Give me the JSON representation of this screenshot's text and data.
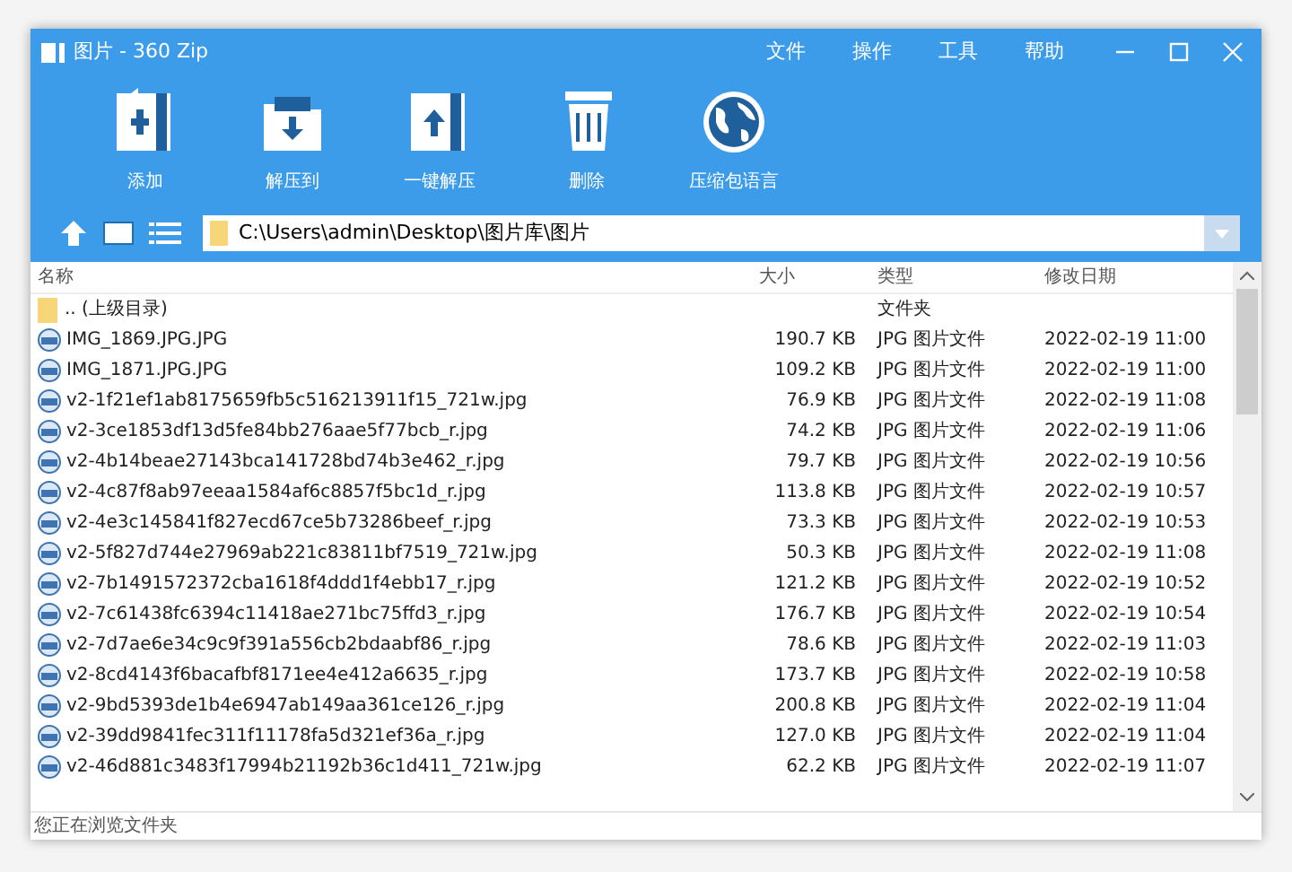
{
  "window": {
    "title": "图片 - 360 Zip"
  },
  "menu": [
    "文件",
    "操作",
    "工具",
    "帮助"
  ],
  "toolbar": [
    {
      "kind": "add",
      "label": "添加"
    },
    {
      "kind": "extract",
      "label": "解压到"
    },
    {
      "kind": "oneclick",
      "label": "一键解压"
    },
    {
      "kind": "delete",
      "label": "删除"
    },
    {
      "kind": "language",
      "label": "压缩包语言"
    }
  ],
  "address": {
    "value": "C:\\Users\\admin\\Desktop\\图片库\\图片"
  },
  "table": {
    "columns": [
      "名称",
      "大小",
      "类型",
      "修改日期"
    ],
    "rows": [
      {
        "kind": "folder",
        "name": ".. (上级目录)",
        "type": "文件夹"
      },
      {
        "kind": "file",
        "name": "IMG_1869.JPG.JPG",
        "size": "190.7 KB",
        "type": "JPG 图片文件",
        "date": "2022-02-19 11:00"
      },
      {
        "kind": "file",
        "name": "IMG_1871.JPG.JPG",
        "size": "109.2 KB",
        "type": "JPG 图片文件",
        "date": "2022-02-19 11:00"
      },
      {
        "kind": "file",
        "name": "v2-1f21ef1ab8175659fb5c516213911f15_721w.jpg",
        "size": "76.9 KB",
        "type": "JPG 图片文件",
        "date": "2022-02-19 11:08"
      },
      {
        "kind": "file",
        "name": "v2-3ce1853df13d5fe84bb276aae5f77bcb_r.jpg",
        "size": "74.2 KB",
        "type": "JPG 图片文件",
        "date": "2022-02-19 11:06"
      },
      {
        "kind": "file",
        "name": "v2-4b14beae27143bca141728bd74b3e462_r.jpg",
        "size": "79.7 KB",
        "type": "JPG 图片文件",
        "date": "2022-02-19 10:56"
      },
      {
        "kind": "file",
        "name": "v2-4c87f8ab97eeaa1584af6c8857f5bc1d_r.jpg",
        "size": "113.8 KB",
        "type": "JPG 图片文件",
        "date": "2022-02-19 10:57"
      },
      {
        "kind": "file",
        "name": "v2-4e3c145841f827ecd67ce5b73286beef_r.jpg",
        "size": "73.3 KB",
        "type": "JPG 图片文件",
        "date": "2022-02-19 10:53"
      },
      {
        "kind": "file",
        "name": "v2-5f827d744e27969ab221c83811bf7519_721w.jpg",
        "size": "50.3 KB",
        "type": "JPG 图片文件",
        "date": "2022-02-19 11:08"
      },
      {
        "kind": "file",
        "name": "v2-7b1491572372cba1618f4ddd1f4ebb17_r.jpg",
        "size": "121.2 KB",
        "type": "JPG 图片文件",
        "date": "2022-02-19 10:52"
      },
      {
        "kind": "file",
        "name": "v2-7c61438fc6394c11418ae271bc75ffd3_r.jpg",
        "size": "176.7 KB",
        "type": "JPG 图片文件",
        "date": "2022-02-19 10:54"
      },
      {
        "kind": "file",
        "name": "v2-7d7ae6e34c9c9f391a556cb2bdaabf86_r.jpg",
        "size": "78.6 KB",
        "type": "JPG 图片文件",
        "date": "2022-02-19 11:03"
      },
      {
        "kind": "file",
        "name": "v2-8cd4143f6bacafbf8171ee4e412a6635_r.jpg",
        "size": "173.7 KB",
        "type": "JPG 图片文件",
        "date": "2022-02-19 10:58"
      },
      {
        "kind": "file",
        "name": "v2-9bd5393de1b4e6947ab149aa361ce126_r.jpg",
        "size": "200.8 KB",
        "type": "JPG 图片文件",
        "date": "2022-02-19 11:04"
      },
      {
        "kind": "file",
        "name": "v2-39dd9841fec311f11178fa5d321ef36a_r.jpg",
        "size": "127.0 KB",
        "type": "JPG 图片文件",
        "date": "2022-02-19 11:04"
      },
      {
        "kind": "file",
        "name": "v2-46d881c3483f17994b21192b36c1d411_721w.jpg",
        "size": "62.2 KB",
        "type": "JPG 图片文件",
        "date": "2022-02-19 11:07"
      }
    ]
  },
  "status_bar": {
    "text": "您正在浏览文件夹"
  }
}
